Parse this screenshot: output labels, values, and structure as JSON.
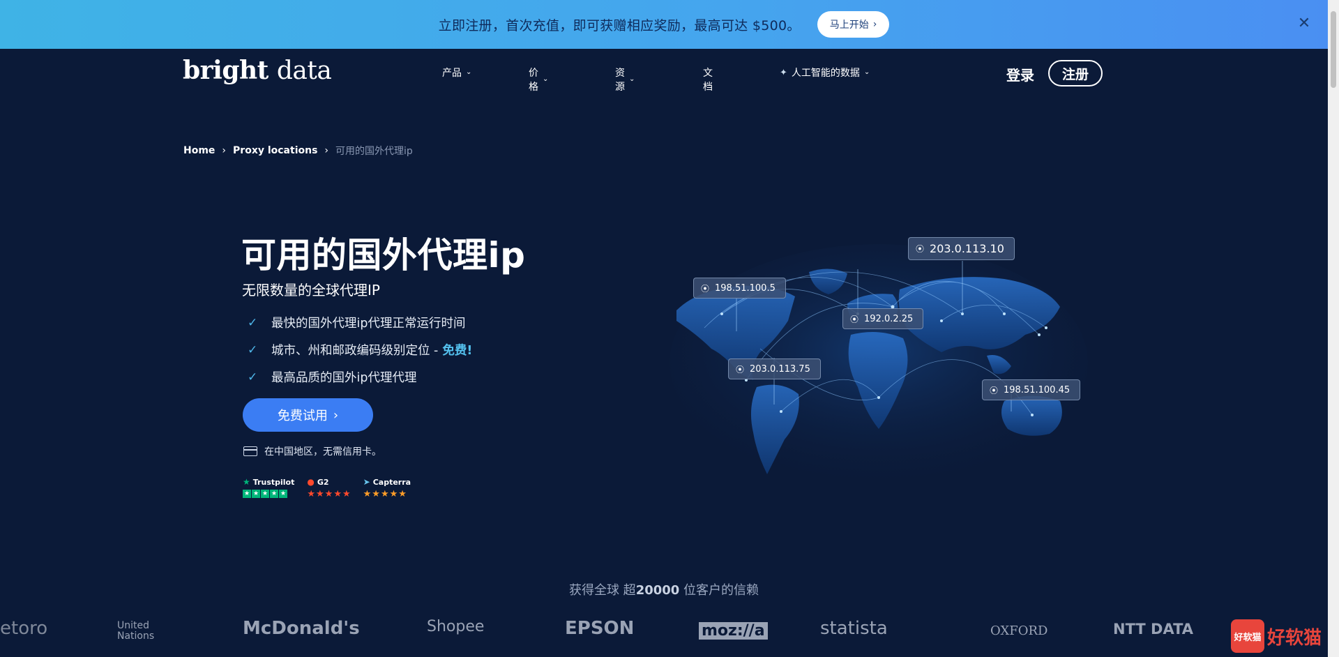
{
  "promo": {
    "text": "立即注册，首次充值，即可获赠相应奖励，最高可达 $500。",
    "button_label": "马上开始",
    "close_label": "✕"
  },
  "header": {
    "logo_bright": "bright",
    "logo_data": "data",
    "nav": [
      {
        "label": "产品"
      },
      {
        "label": "价格"
      },
      {
        "label": "资源"
      },
      {
        "label": "文档"
      },
      {
        "label": "人工智能的数据"
      }
    ],
    "login_label": "登录",
    "signup_label": "注册"
  },
  "breadcrumb": {
    "home": "Home",
    "proxy_locations": "Proxy locations",
    "current": "可用的国外代理ip"
  },
  "hero": {
    "title": "可用的国外代理ip",
    "subtitle": "无限数量的全球代理IP",
    "features": [
      "最快的国外代理ip代理正常运行时间",
      "城市、州和邮政编码级别定位 -",
      "最高品质的国外ip代理代理"
    ],
    "free_tag": "免费!",
    "cta_label": "免费试用",
    "card_note": "在中国地区，无需信用卡。"
  },
  "ratings": [
    {
      "name": "Trustpilot"
    },
    {
      "name": "G2"
    },
    {
      "name": "Capterra"
    }
  ],
  "map": {
    "ips": [
      "203.0.113.10",
      "198.51.100.5",
      "192.0.2.25",
      "203.0.113.75",
      "198.51.100.45"
    ]
  },
  "trust": {
    "prefix": "获得全球 超",
    "count": "20000",
    "suffix": " 位客户的信赖"
  },
  "brands": [
    "etoro",
    "United Nations",
    "McDonald's",
    "Shopee",
    "EPSON",
    "moz://a",
    "statista",
    "OXFORD",
    "NTT DATA"
  ],
  "watermark": {
    "box": "好软猫",
    "text": "好软猫"
  },
  "colors": {
    "accent": "#3b7df3",
    "bg": "#0b1a38",
    "free": "#54c1ee"
  }
}
